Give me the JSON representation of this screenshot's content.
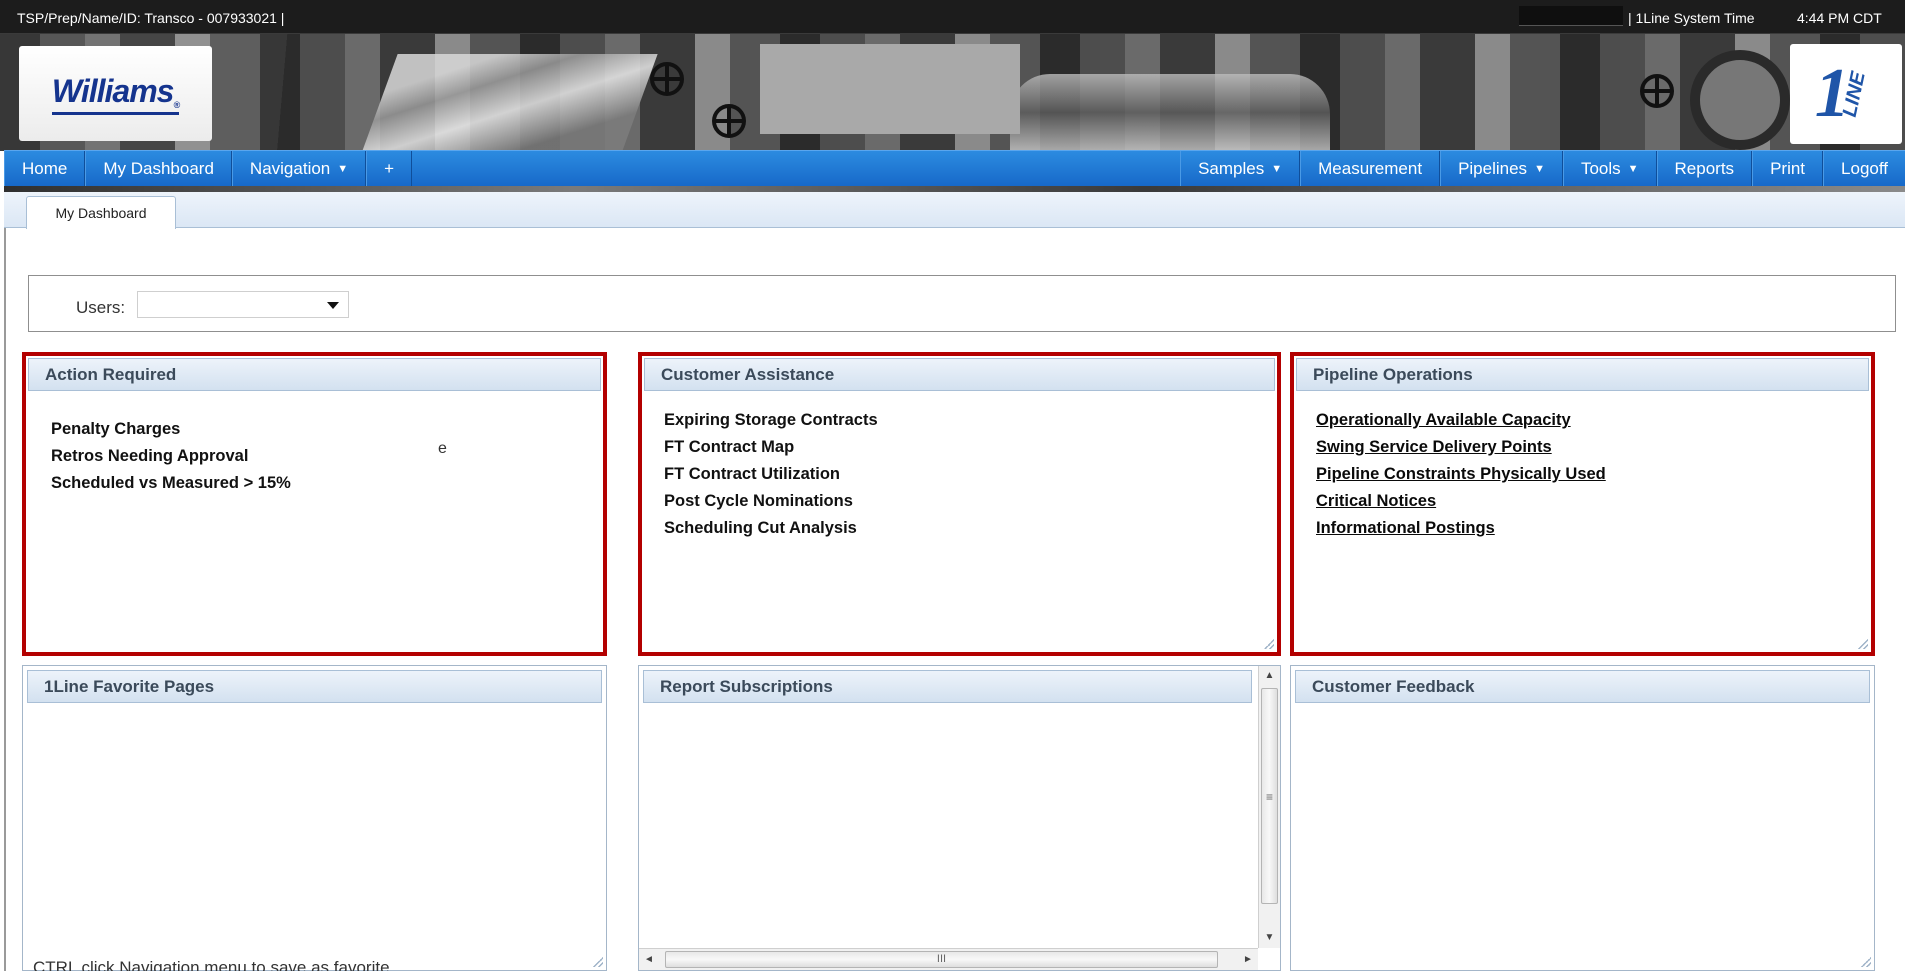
{
  "infobar": {
    "tsp": "TSP/Prep/Name/ID: Transco - 007933021  |",
    "time_label": "|  1Line System Time",
    "time_value": "4:44 PM CDT"
  },
  "logos": {
    "williams": "Williams",
    "williams_mark": "®",
    "oneline_one": "1",
    "oneline_line": "LINE"
  },
  "nav": {
    "left": [
      {
        "label": "Home",
        "dropdown": false
      },
      {
        "label": "My Dashboard",
        "dropdown": false
      },
      {
        "label": "Navigation",
        "dropdown": true
      },
      {
        "label": "+",
        "dropdown": false
      }
    ],
    "right": [
      {
        "label": "Samples",
        "dropdown": true
      },
      {
        "label": "Measurement",
        "dropdown": false
      },
      {
        "label": "Pipelines",
        "dropdown": true
      },
      {
        "label": "Tools",
        "dropdown": true
      },
      {
        "label": "Reports",
        "dropdown": false
      },
      {
        "label": "Print",
        "dropdown": false
      },
      {
        "label": "Logoff",
        "dropdown": false
      }
    ],
    "caret": "▼"
  },
  "tab": {
    "label": "My Dashboard"
  },
  "users": {
    "label": "Users:",
    "value": ""
  },
  "panels": {
    "action_required": {
      "title": "Action Required",
      "items": [
        "Penalty Charges",
        "Retros Needing Approval",
        "Scheduled vs Measured > 15%"
      ],
      "stray": "e"
    },
    "customer_assistance": {
      "title": "Customer Assistance",
      "items": [
        "Expiring Storage Contracts",
        "FT Contract Map",
        "FT Contract Utilization",
        "Post Cycle Nominations",
        "Scheduling Cut Analysis"
      ]
    },
    "pipeline_operations": {
      "title": "Pipeline Operations",
      "items": [
        "Operationally Available Capacity",
        "Swing Service Delivery Points",
        "Pipeline Constraints Physically Used",
        "Critical Notices",
        "Informational Postings"
      ]
    },
    "favorite_pages": {
      "title": "1Line Favorite Pages",
      "footnote": "CTRL click Navigation menu to save as favorite."
    },
    "report_subscriptions": {
      "title": "Report Subscriptions"
    },
    "customer_feedback": {
      "title": "Customer Feedback"
    }
  },
  "scroll": {
    "up": "▲",
    "down": "▼",
    "left": "◄",
    "right": "►",
    "vgrip": "≡",
    "hgrip": "III"
  },
  "colors": {
    "nav_blue": "#1769c9",
    "highlight_red": "#b30000",
    "header_text": "#3b4a5a"
  }
}
